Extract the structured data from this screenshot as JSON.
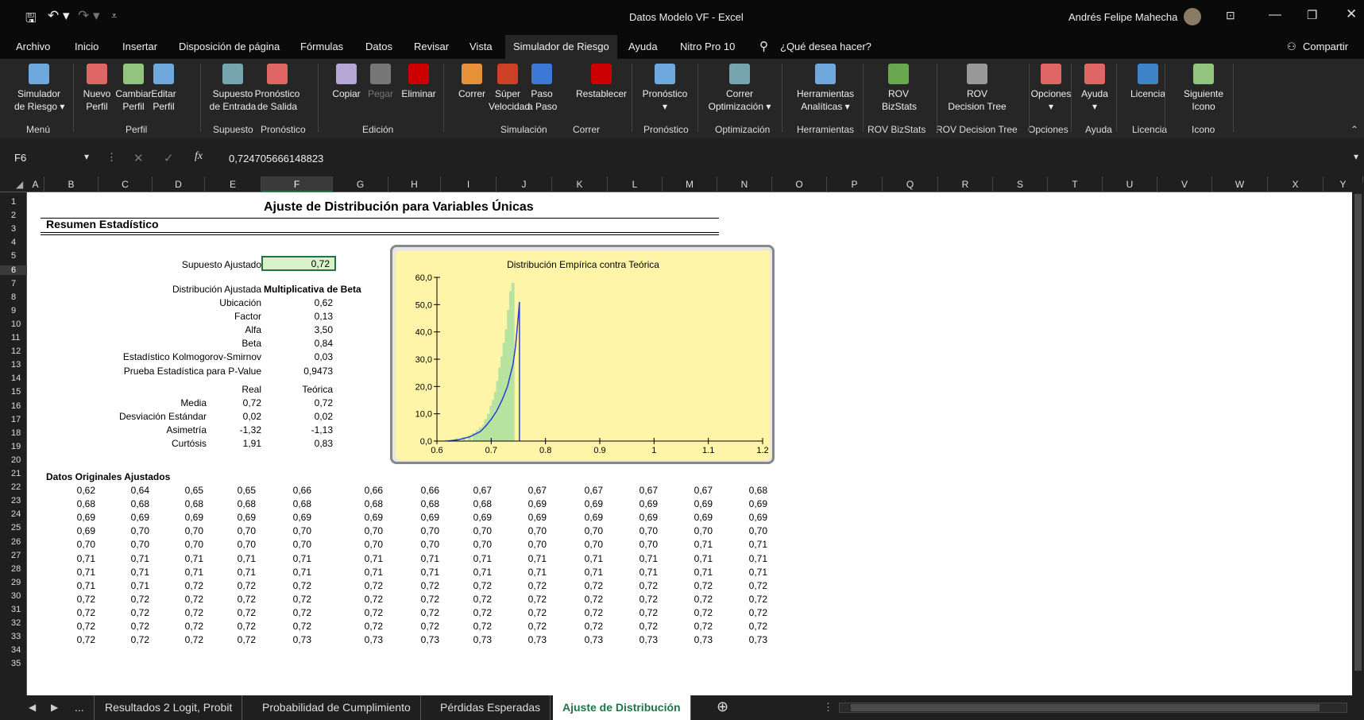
{
  "window": {
    "title": "Datos Modelo VF - Excel",
    "user": "Andrés Felipe Mahecha"
  },
  "menu": {
    "tabs": [
      "Archivo",
      "Inicio",
      "Insertar",
      "Disposición de página",
      "Fórmulas",
      "Datos",
      "Revisar",
      "Vista",
      "Simulador de Riesgo",
      "Ayuda",
      "Nitro Pro 10"
    ],
    "active": "Simulador de Riesgo",
    "tell_me": "¿Qué desea hacer?",
    "share": "Compartir"
  },
  "ribbon": {
    "buttons": [
      {
        "l1": "Simulador",
        "l2": "de Riesgo ▾",
        "icon": "simulator-icon",
        "color": "#6fa8dc"
      },
      {
        "l1": "Nuevo",
        "l2": "Perfil",
        "icon": "new-profile-icon",
        "color": "#e06666"
      },
      {
        "l1": "Cambiar",
        "l2": "Perfil",
        "icon": "change-profile-icon",
        "color": "#93c47d"
      },
      {
        "l1": "Editar",
        "l2": "Perfil",
        "icon": "edit-profile-icon",
        "color": "#6fa8dc"
      },
      {
        "l1": "Supuesto",
        "l2": "de Entrada",
        "icon": "input-assumption-icon",
        "color": "#76a5af"
      },
      {
        "l1": "Pronóstico",
        "l2": "de Salida",
        "icon": "output-forecast-icon",
        "color": "#e06666"
      },
      {
        "l1": "Copiar",
        "l2": "",
        "icon": "copy-icon",
        "color": "#b4a7d6"
      },
      {
        "l1": "Pegar",
        "l2": "",
        "icon": "paste-icon",
        "color": "#777777"
      },
      {
        "l1": "Eliminar",
        "l2": "",
        "icon": "delete-icon",
        "color": "#cc0000"
      },
      {
        "l1": "Correr",
        "l2": "",
        "icon": "run-icon",
        "color": "#e69138"
      },
      {
        "l1": "Súper",
        "l2": "Velocidad",
        "icon": "super-speed-icon",
        "color": "#cc4125"
      },
      {
        "l1": "Paso",
        "l2": "a Paso",
        "icon": "step-icon",
        "color": "#3c78d8"
      },
      {
        "l1": "Restablecer",
        "l2": "",
        "icon": "reset-icon",
        "color": "#cc0000"
      },
      {
        "l1": "Pronóstico",
        "l2": "▾",
        "icon": "forecast-icon",
        "color": "#6fa8dc"
      },
      {
        "l1": "Correr",
        "l2": "Optimización ▾",
        "icon": "optimization-icon",
        "color": "#76a5af"
      },
      {
        "l1": "Herramientas",
        "l2": "Analíticas ▾",
        "icon": "analytics-icon",
        "color": "#6fa8dc"
      },
      {
        "l1": "ROV",
        "l2": "BizStats",
        "icon": "bizstats-icon",
        "color": "#6aa84f"
      },
      {
        "l1": "ROV",
        "l2": "Decision Tree",
        "icon": "decision-tree-icon",
        "color": "#999999"
      },
      {
        "l1": "Opciones",
        "l2": "▾",
        "icon": "options-icon",
        "color": "#e06666"
      },
      {
        "l1": "Ayuda",
        "l2": "▾",
        "icon": "help-icon",
        "color": "#e06666"
      },
      {
        "l1": "Licencia",
        "l2": "",
        "icon": "license-icon",
        "color": "#3d85c6"
      },
      {
        "l1": "Siguiente",
        "l2": "Icono",
        "icon": "next-icon",
        "color": "#93c47d"
      }
    ],
    "groups": [
      "Menú",
      "Perfil",
      "Supuesto",
      "Pronóstico",
      "Edición",
      "Simulación",
      "Correr",
      "Pronóstico",
      "Optimización",
      "Herramientas",
      "ROV BizStats",
      "ROV Decision Tree",
      "Opciones",
      "Ayuda",
      "Licencia",
      "Icono"
    ]
  },
  "formula_bar": {
    "name_box": "F6",
    "value": "0,724705666148823"
  },
  "columns": [
    "A",
    "B",
    "C",
    "D",
    "E",
    "F",
    "G",
    "H",
    "I",
    "J",
    "K",
    "L",
    "M",
    "N",
    "O",
    "P",
    "Q",
    "R",
    "S",
    "T",
    "U",
    "V",
    "W",
    "X",
    "Y"
  ],
  "rows": [
    "1",
    "2",
    "3",
    "4",
    "5",
    "6",
    "7",
    "8",
    "9",
    "10",
    "11",
    "12",
    "13",
    "14",
    "15",
    "16",
    "17",
    "18",
    "19",
    "20",
    "21",
    "22",
    "23",
    "24",
    "25",
    "26",
    "27",
    "28",
    "29",
    "30",
    "31",
    "32",
    "33",
    "34",
    "35"
  ],
  "report": {
    "title": "Ajuste de Distribución para Variables Únicas",
    "summary_header": "Resumen Estadístico",
    "assumption_label": "Supuesto Ajustado",
    "assumption_value": "0,72",
    "fitted_label": "Distribución Ajustada",
    "fitted_value": "Multiplicativa de Beta",
    "params": [
      {
        "label": "Ubicación",
        "value": "0,62"
      },
      {
        "label": "Factor",
        "value": "0,13"
      },
      {
        "label": "Alfa",
        "value": "3,50"
      },
      {
        "label": "Beta",
        "value": "0,84"
      },
      {
        "label": "Estadístico Kolmogorov-Smirnov",
        "value": "0,03"
      },
      {
        "label": "Prueba Estadística para P-Value",
        "value": "0,9473"
      }
    ],
    "moments_header": {
      "real": "Real",
      "theoretical": "Teórica"
    },
    "moments": [
      {
        "label": "Media",
        "real": "0,72",
        "theo": "0,72"
      },
      {
        "label": "Desviación Estándar",
        "real": "0,02",
        "theo": "0,02"
      },
      {
        "label": "Asimetría",
        "real": "-1,32",
        "theo": "-1,13"
      },
      {
        "label": "Curtósis",
        "real": "1,91",
        "theo": "0,83"
      }
    ],
    "data_header": "Datos Originales Ajustados",
    "data_rows": [
      [
        "0,62",
        "0,64",
        "0,65",
        "0,65",
        "0,66",
        "0,66",
        "0,66",
        "0,67",
        "0,67",
        "0,67",
        "0,67",
        "0,67",
        "0,68"
      ],
      [
        "0,68",
        "0,68",
        "0,68",
        "0,68",
        "0,68",
        "0,68",
        "0,68",
        "0,68",
        "0,69",
        "0,69",
        "0,69",
        "0,69",
        "0,69"
      ],
      [
        "0,69",
        "0,69",
        "0,69",
        "0,69",
        "0,69",
        "0,69",
        "0,69",
        "0,69",
        "0,69",
        "0,69",
        "0,69",
        "0,69",
        "0,69"
      ],
      [
        "0,69",
        "0,70",
        "0,70",
        "0,70",
        "0,70",
        "0,70",
        "0,70",
        "0,70",
        "0,70",
        "0,70",
        "0,70",
        "0,70",
        "0,70"
      ],
      [
        "0,70",
        "0,70",
        "0,70",
        "0,70",
        "0,70",
        "0,70",
        "0,70",
        "0,70",
        "0,70",
        "0,70",
        "0,70",
        "0,71",
        "0,71"
      ],
      [
        "0,71",
        "0,71",
        "0,71",
        "0,71",
        "0,71",
        "0,71",
        "0,71",
        "0,71",
        "0,71",
        "0,71",
        "0,71",
        "0,71",
        "0,71"
      ],
      [
        "0,71",
        "0,71",
        "0,71",
        "0,71",
        "0,71",
        "0,71",
        "0,71",
        "0,71",
        "0,71",
        "0,71",
        "0,71",
        "0,71",
        "0,71"
      ],
      [
        "0,71",
        "0,71",
        "0,72",
        "0,72",
        "0,72",
        "0,72",
        "0,72",
        "0,72",
        "0,72",
        "0,72",
        "0,72",
        "0,72",
        "0,72"
      ],
      [
        "0,72",
        "0,72",
        "0,72",
        "0,72",
        "0,72",
        "0,72",
        "0,72",
        "0,72",
        "0,72",
        "0,72",
        "0,72",
        "0,72",
        "0,72"
      ],
      [
        "0,72",
        "0,72",
        "0,72",
        "0,72",
        "0,72",
        "0,72",
        "0,72",
        "0,72",
        "0,72",
        "0,72",
        "0,72",
        "0,72",
        "0,72"
      ],
      [
        "0,72",
        "0,72",
        "0,72",
        "0,72",
        "0,72",
        "0,72",
        "0,72",
        "0,72",
        "0,72",
        "0,72",
        "0,72",
        "0,72",
        "0,72"
      ],
      [
        "0,72",
        "0,72",
        "0,72",
        "0,72",
        "0,73",
        "0,73",
        "0,73",
        "0,73",
        "0,73",
        "0,73",
        "0,73",
        "0,73",
        "0,73"
      ]
    ]
  },
  "chart_data": {
    "type": "bar",
    "title": "Distribución Empírica contra Teórica",
    "xlabel": "",
    "ylabel": "",
    "xlim": [
      0.6,
      1.2
    ],
    "ylim": [
      0,
      60
    ],
    "x_ticks": [
      "0.6",
      "0.7",
      "0.8",
      "0.9",
      "1",
      "1.1",
      "1.2"
    ],
    "y_ticks": [
      "0,0",
      "10,0",
      "20,0",
      "30,0",
      "40,0",
      "50,0",
      "60,0"
    ],
    "grid": false,
    "legend": "none",
    "series": [
      {
        "kind": "bars",
        "x": [
          0.618,
          0.636,
          0.65,
          0.66,
          0.668,
          0.674,
          0.68,
          0.686,
          0.69,
          0.695,
          0.7,
          0.704,
          0.708,
          0.712,
          0.716,
          0.72,
          0.724,
          0.728,
          0.732,
          0.736,
          0.74
        ],
        "values": [
          0.5,
          1,
          1.5,
          2,
          3,
          4,
          5,
          6,
          8,
          10,
          13,
          15,
          18,
          22,
          27,
          31,
          36,
          41,
          48,
          55,
          58
        ],
        "color": "#b6e3a0"
      },
      {
        "kind": "line",
        "x": [
          0.62,
          0.64,
          0.66,
          0.68,
          0.69,
          0.7,
          0.71,
          0.72,
          0.73,
          0.74,
          0.745,
          0.75,
          0.752
        ],
        "values": [
          0,
          0.5,
          1.5,
          3.5,
          5.5,
          8,
          11,
          15,
          20,
          28,
          35,
          46,
          51
        ],
        "color": "#2a3fd1"
      }
    ],
    "bg_color": "#fff5a8"
  },
  "sheet_tabs": {
    "tabs": [
      "Resultados 2 Logit, Probit",
      "Probabilidad de Cumplimiento",
      "Pérdidas Esperadas",
      "Ajuste de Distribución"
    ],
    "active": "Ajuste de Distribución",
    "more": "..."
  }
}
